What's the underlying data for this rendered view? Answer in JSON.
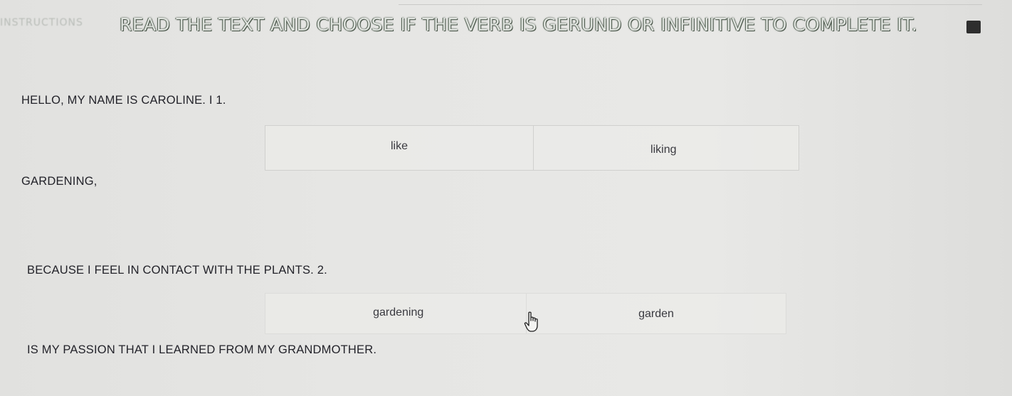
{
  "instruction": {
    "prefix": "INSTRUCTIONS",
    "text": "READ THE TEXT AND CHOOSE IF THE VERB IS GERUND OR INFINITIVE TO COMPLETE IT."
  },
  "passage": {
    "line1": "HELLO, MY NAME IS CAROLINE. I 1.",
    "line2": "GARDENING,",
    "line3": "BECAUSE I FEEL IN CONTACT WITH THE PLANTS. 2.",
    "line4": "IS MY PASSION THAT I LEARNED FROM MY GRANDMOTHER."
  },
  "question1": {
    "options": [
      "like",
      "liking"
    ]
  },
  "question2": {
    "options": [
      "gardening",
      "garden"
    ]
  },
  "icons": {
    "cursor": "hand-pointer-icon"
  }
}
